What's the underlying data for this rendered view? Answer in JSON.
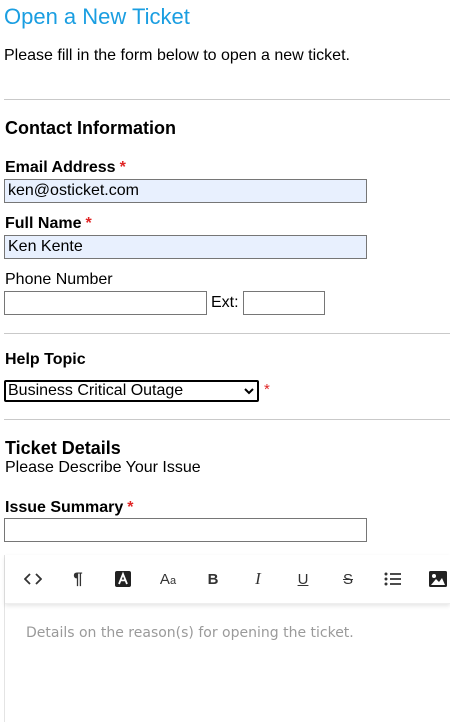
{
  "page": {
    "title": "Open a New Ticket",
    "intro": "Please fill in the form below to open a new ticket."
  },
  "contact": {
    "heading": "Contact Information",
    "email_label": "Email Address",
    "email_value": "ken@osticket.com",
    "name_label": "Full Name",
    "name_value": "Ken Kente",
    "phone_label": "Phone Number",
    "phone_value": "",
    "ext_label": "Ext:",
    "ext_value": "",
    "required_mark": "*"
  },
  "help_topic": {
    "heading": "Help Topic",
    "selected": "Business Critical Outage"
  },
  "ticket": {
    "heading": "Ticket Details",
    "subheading": "Please Describe Your Issue",
    "summary_label": "Issue Summary",
    "summary_value": "",
    "details_placeholder": "Details on the reason(s) for opening the ticket."
  },
  "toolbar": {
    "buttons": [
      {
        "name": "code-view-button",
        "icon": "code-icon"
      },
      {
        "name": "paragraph-format-button",
        "icon": "pilcrow-icon"
      },
      {
        "name": "font-color-button",
        "icon": "text-color-icon"
      },
      {
        "name": "font-size-button",
        "icon": "font-size-icon"
      },
      {
        "name": "bold-button",
        "icon": "bold-icon"
      },
      {
        "name": "italic-button",
        "icon": "italic-icon"
      },
      {
        "name": "underline-button",
        "icon": "underline-icon"
      },
      {
        "name": "strikethrough-button",
        "icon": "strikethrough-icon"
      },
      {
        "name": "bulleted-list-button",
        "icon": "list-icon"
      },
      {
        "name": "insert-image-button",
        "icon": "image-icon"
      }
    ]
  },
  "colors": {
    "title": "#1a9ee1",
    "required": "#e02626",
    "autofill": "#e8f0fe",
    "placeholder": "#9a9a9a"
  }
}
